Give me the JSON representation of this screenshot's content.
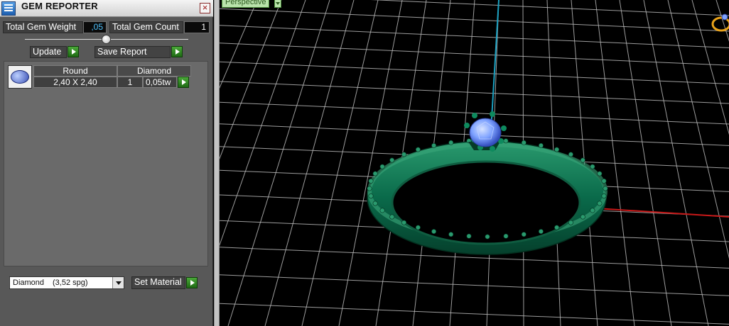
{
  "window": {
    "title": "GEM REPORTER",
    "close_icon": "close-icon",
    "app_icon": "gem-reporter-icon"
  },
  "stats": {
    "total_weight_label": "Total Gem Weight",
    "total_weight_value": ",05",
    "total_count_label": "Total Gem Count",
    "total_count_value": "1"
  },
  "buttons": {
    "update": "Update",
    "save_report": "Save Report",
    "set_material": "Set Material"
  },
  "gem_table": {
    "headers": {
      "shape": "Round",
      "material": "Diamond"
    },
    "rows": [
      {
        "size": "2,40 X 2,40",
        "count": "1",
        "weight": "0,05tw"
      }
    ]
  },
  "material": {
    "selected_name": "Diamond",
    "selected_density": "(3,52 spg)"
  },
  "viewport": {
    "view_label": "Perspective",
    "colors": {
      "grid": "#b8b8b8",
      "axis_x": "#c81818",
      "axis_z": "#1aa0c0",
      "ring": "#0a6a4a",
      "ring_highlight": "#2a9a6e",
      "gem": "#7ea2ff"
    }
  }
}
